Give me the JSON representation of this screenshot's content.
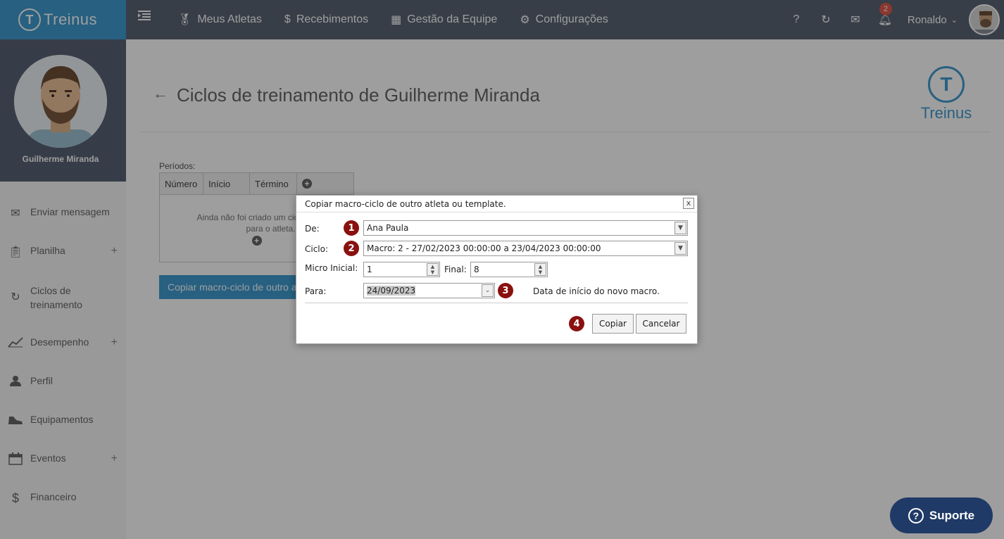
{
  "brand": {
    "name": "Treinus"
  },
  "nav": {
    "items": [
      {
        "label": "Meus Atletas",
        "icon": "medal-icon"
      },
      {
        "label": "Recebimentos",
        "icon": "dollar-icon"
      },
      {
        "label": "Gestão da Equipe",
        "icon": "contacts-icon"
      },
      {
        "label": "Configurações",
        "icon": "gears-icon"
      }
    ]
  },
  "topbar": {
    "help": "?",
    "notification_count": "2",
    "user_name": "Ronaldo"
  },
  "sidebar": {
    "athlete_name": "Guilherme Miranda",
    "items": [
      {
        "label": "Enviar mensagem",
        "icon": "envelope-icon",
        "plus": ""
      },
      {
        "label": "Planilha",
        "icon": "clipboard-icon",
        "plus": "+"
      },
      {
        "label": "Ciclos de treinamento",
        "icon": "cycle-icon",
        "plus": ""
      },
      {
        "label": "Desempenho",
        "icon": "chart-line-icon",
        "plus": "+"
      },
      {
        "label": "Perfil",
        "icon": "user-icon",
        "plus": ""
      },
      {
        "label": "Equipamentos",
        "icon": "shoe-icon",
        "plus": ""
      },
      {
        "label": "Eventos",
        "icon": "calendar-icon",
        "plus": "+"
      },
      {
        "label": "Financeiro",
        "icon": "dollar-icon",
        "plus": ""
      }
    ]
  },
  "page": {
    "title": "Ciclos de treinamento de Guilherme Miranda",
    "logo_text": "Treinus",
    "periods_label": "Períodos:",
    "columns": [
      "Número",
      "Início",
      "Término"
    ],
    "empty_text_1": "Ainda não foi criado um ciclo de",
    "empty_text_2": "para o atleta.",
    "copy_button": "Copiar macro-ciclo de outro atleta"
  },
  "dialog": {
    "title": "Copiar macro-ciclo de outro atleta ou template.",
    "close": "x",
    "de_label": "De:",
    "de_value": "Ana Paula",
    "ciclo_label": "Ciclo:",
    "ciclo_value": "Macro: 2 - 27/02/2023 00:00:00 a 23/04/2023 00:00:00",
    "micro_label": "Micro Inicial:",
    "micro_value": "1",
    "final_label": "Final:",
    "final_value": "8",
    "para_label": "Para:",
    "para_value": "24/09/2023",
    "para_hint": "Data de início do novo macro.",
    "copy_label": "Copiar",
    "cancel_label": "Cancelar",
    "markers": [
      "1",
      "2",
      "3",
      "4"
    ]
  },
  "support": {
    "label": "Suporte"
  }
}
